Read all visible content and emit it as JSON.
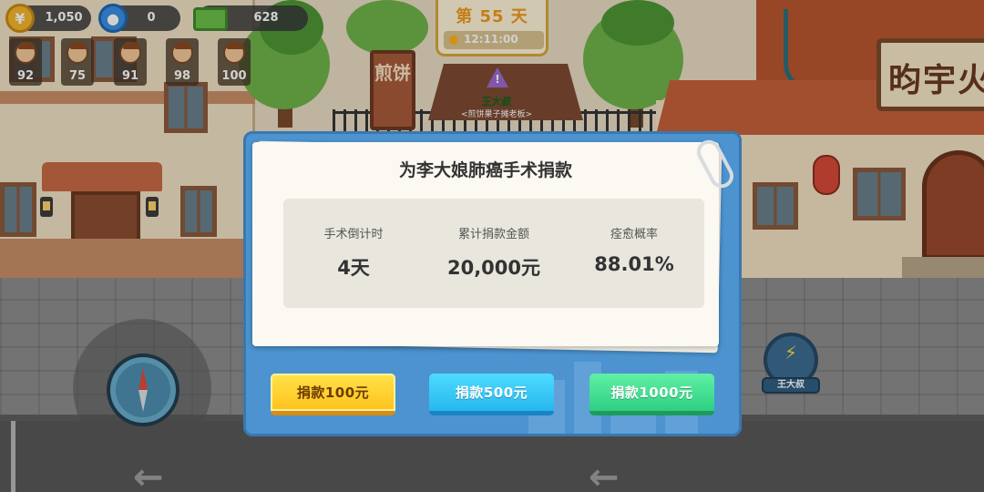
{
  "hud": {
    "coins": "1,050",
    "followers": "0",
    "cash": "628",
    "npcs": [
      {
        "value": "92"
      },
      {
        "value": "75"
      },
      {
        "value": "91"
      },
      {
        "value": "98"
      },
      {
        "value": "100"
      }
    ],
    "day": "第 55 天",
    "time": "12:11:00"
  },
  "scene": {
    "stall_sign": "煎饼",
    "npc_name": "王大叔",
    "npc_subtitle": "<煎饼果子摊老板>",
    "shop_sign": "昀宇火"
  },
  "action_button": {
    "label": "王大叔"
  },
  "modal": {
    "title": "为李大娘肺癌手术捐款",
    "stats": [
      {
        "label": "手术倒计时",
        "value": "4天"
      },
      {
        "label": "累计捐款金额",
        "value": "20,000元"
      },
      {
        "label": "痊愈概率",
        "value": "88.01%"
      }
    ],
    "buttons": [
      {
        "label": "捐款100元"
      },
      {
        "label": "捐款500元"
      },
      {
        "label": "捐款1000元"
      }
    ]
  },
  "colors": {
    "modal_blue": "#4c93cf",
    "button_yellow": "#ffc21c",
    "button_blue": "#26b7ee",
    "button_green": "#2fcf83",
    "day_orange": "#f09a1a"
  }
}
